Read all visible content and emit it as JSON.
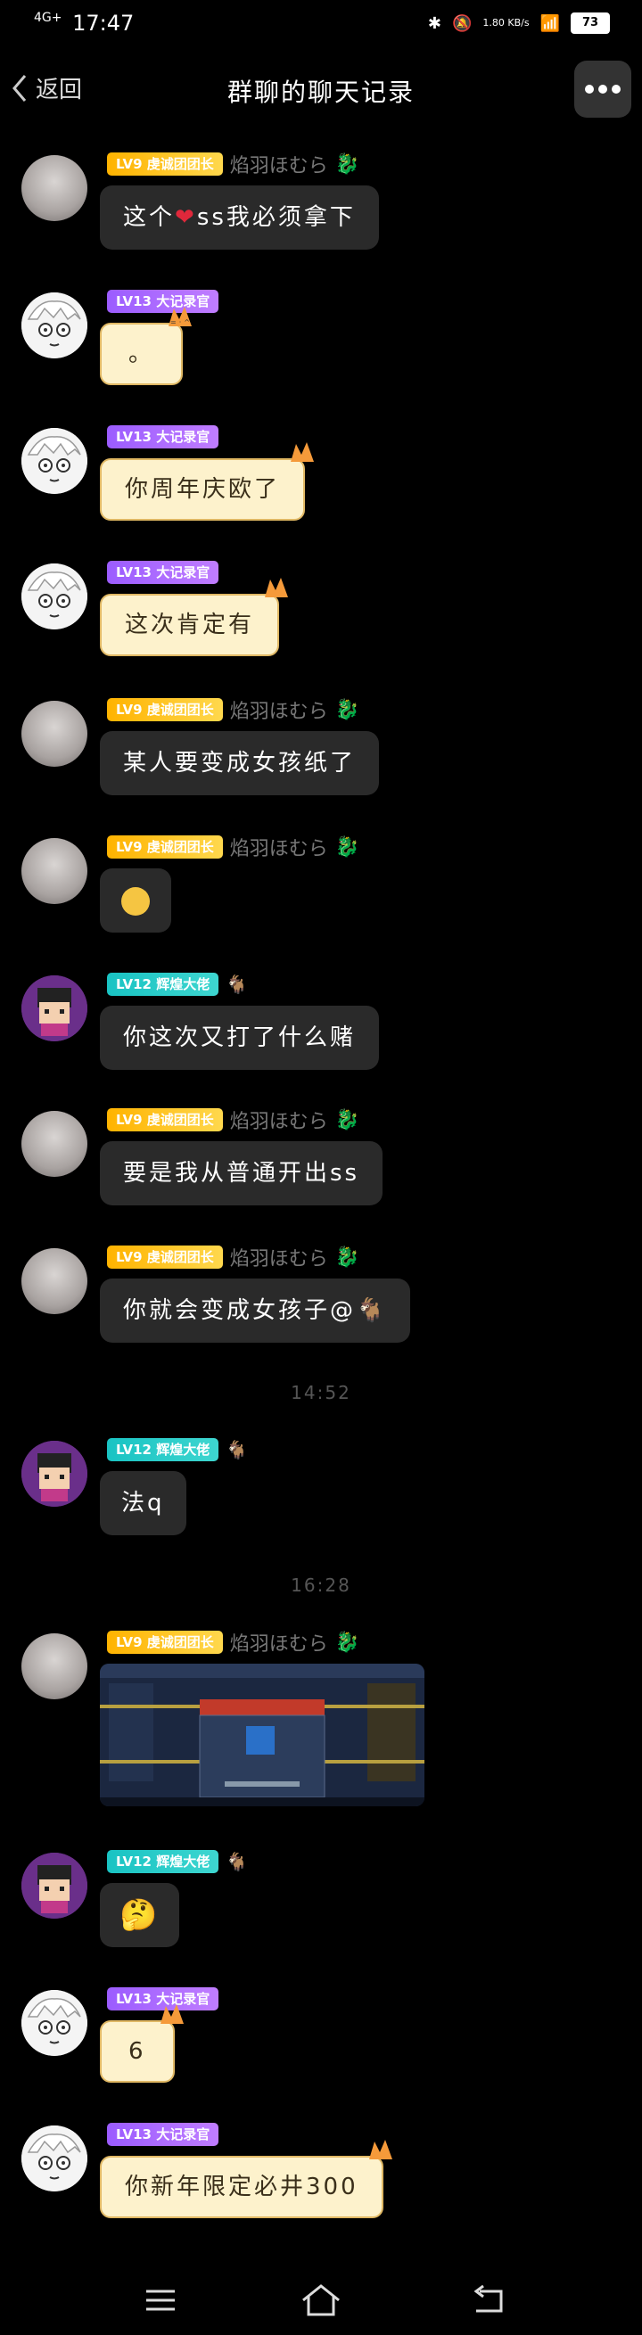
{
  "status": {
    "network": "4G+",
    "time": "17:47",
    "speed": "1.80 KB/s",
    "battery": "73"
  },
  "header": {
    "back_label": "返回",
    "title": "群聊的聊天记录"
  },
  "badges": {
    "lv9": "LV9 虔诚团团长",
    "lv13": "LV13 大记录官",
    "lv12": "LV12 辉煌大佬"
  },
  "users": {
    "homura": "焰羽ほむら"
  },
  "messages": [
    {
      "user": "homura",
      "text_before": "这个",
      "text_after": "ss我必须拿下"
    },
    {
      "user": "lv13",
      "text": "。"
    },
    {
      "user": "lv13",
      "text": "你周年庆欧了"
    },
    {
      "user": "lv13",
      "text": "这次肯定有"
    },
    {
      "user": "homura",
      "text": "某人要变成女孩纸了"
    },
    {
      "user": "homura",
      "text": ""
    },
    {
      "user": "lv12",
      "text": "你这次又打了什么赌"
    },
    {
      "user": "homura",
      "text": "要是我从普通开出ss"
    },
    {
      "user": "homura",
      "text": "你就会变成女孩子@"
    },
    {
      "user": "lv12",
      "text": "法q"
    },
    {
      "user": "homura",
      "text": ""
    },
    {
      "user": "lv12",
      "text": ""
    },
    {
      "user": "lv13",
      "text": "6"
    },
    {
      "user": "lv13",
      "text": "你新年限定必井300"
    }
  ],
  "timestamps": [
    "14:52",
    "16:28"
  ],
  "icons": {
    "back": "chevron-left-icon",
    "more": "more-dots-icon",
    "menu": "menu-icon",
    "home": "home-icon",
    "return": "return-icon"
  }
}
